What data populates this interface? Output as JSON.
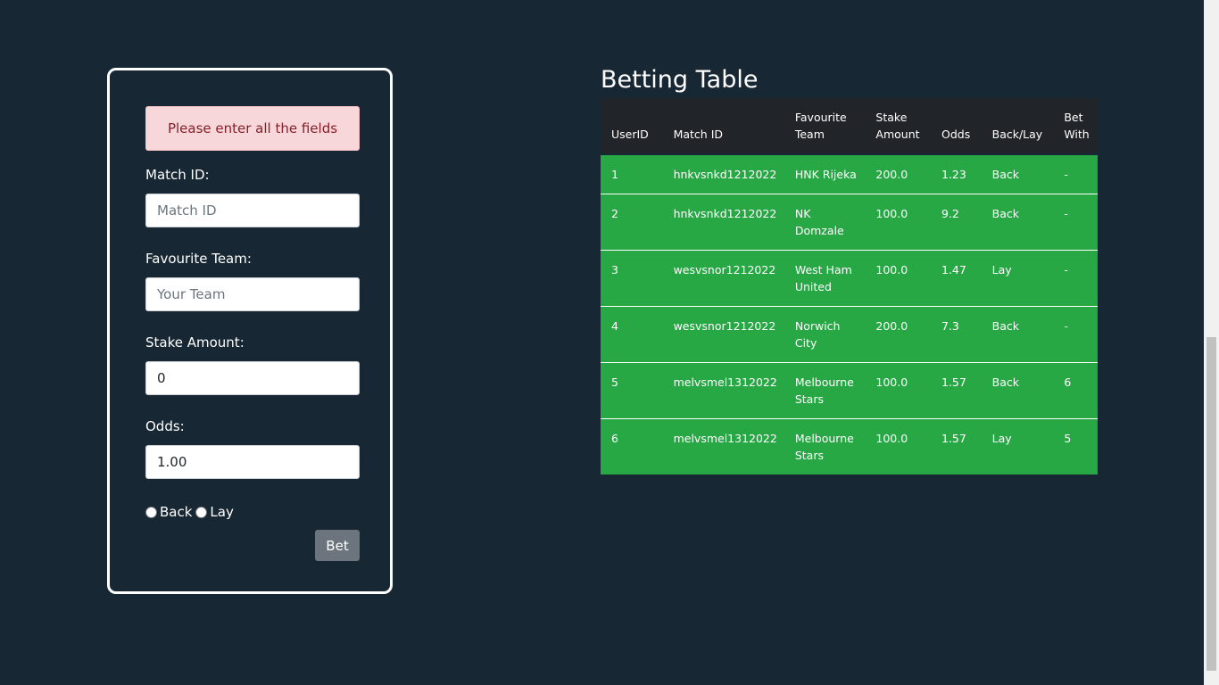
{
  "form": {
    "alert": "Please enter all the fields",
    "match_id": {
      "label": "Match ID:",
      "placeholder": "Match ID",
      "value": ""
    },
    "favourite_team": {
      "label": "Favourite Team:",
      "placeholder": "Your Team",
      "value": ""
    },
    "stake_amount": {
      "label": "Stake Amount:",
      "value": "0"
    },
    "odds": {
      "label": "Odds:",
      "value": "1.00"
    },
    "radio_back": "Back",
    "radio_lay": "Lay",
    "bet_label": "Bet"
  },
  "table": {
    "title": "Betting Table",
    "headers": [
      "UserID",
      "Match ID",
      "Favourite Team",
      "Stake Amount",
      "Odds",
      "Back/Lay",
      "Bet With"
    ],
    "rows": [
      [
        "1",
        "hnkvsnkd1212022",
        "HNK Rijeka",
        "200.0",
        "1.23",
        "Back",
        "-"
      ],
      [
        "2",
        "hnkvsnkd1212022",
        "NK Domzale",
        "100.0",
        "9.2",
        "Back",
        "-"
      ],
      [
        "3",
        "wesvsnor1212022",
        "West Ham United",
        "100.0",
        "1.47",
        "Lay",
        "-"
      ],
      [
        "4",
        "wesvsnor1212022",
        "Norwich City",
        "200.0",
        "7.3",
        "Back",
        "-"
      ],
      [
        "5",
        "melvsmel1312022",
        "Melbourne Stars",
        "100.0",
        "1.57",
        "Back",
        "6"
      ],
      [
        "6",
        "melvsmel1312022",
        "Melbourne Stars",
        "100.0",
        "1.57",
        "Lay",
        "5"
      ]
    ]
  },
  "colors": {
    "background": "#172733",
    "table_row": "#28a745",
    "table_header": "#212529",
    "alert_bg": "#f8d7da",
    "alert_text": "#842029",
    "button": "#6c757d"
  }
}
